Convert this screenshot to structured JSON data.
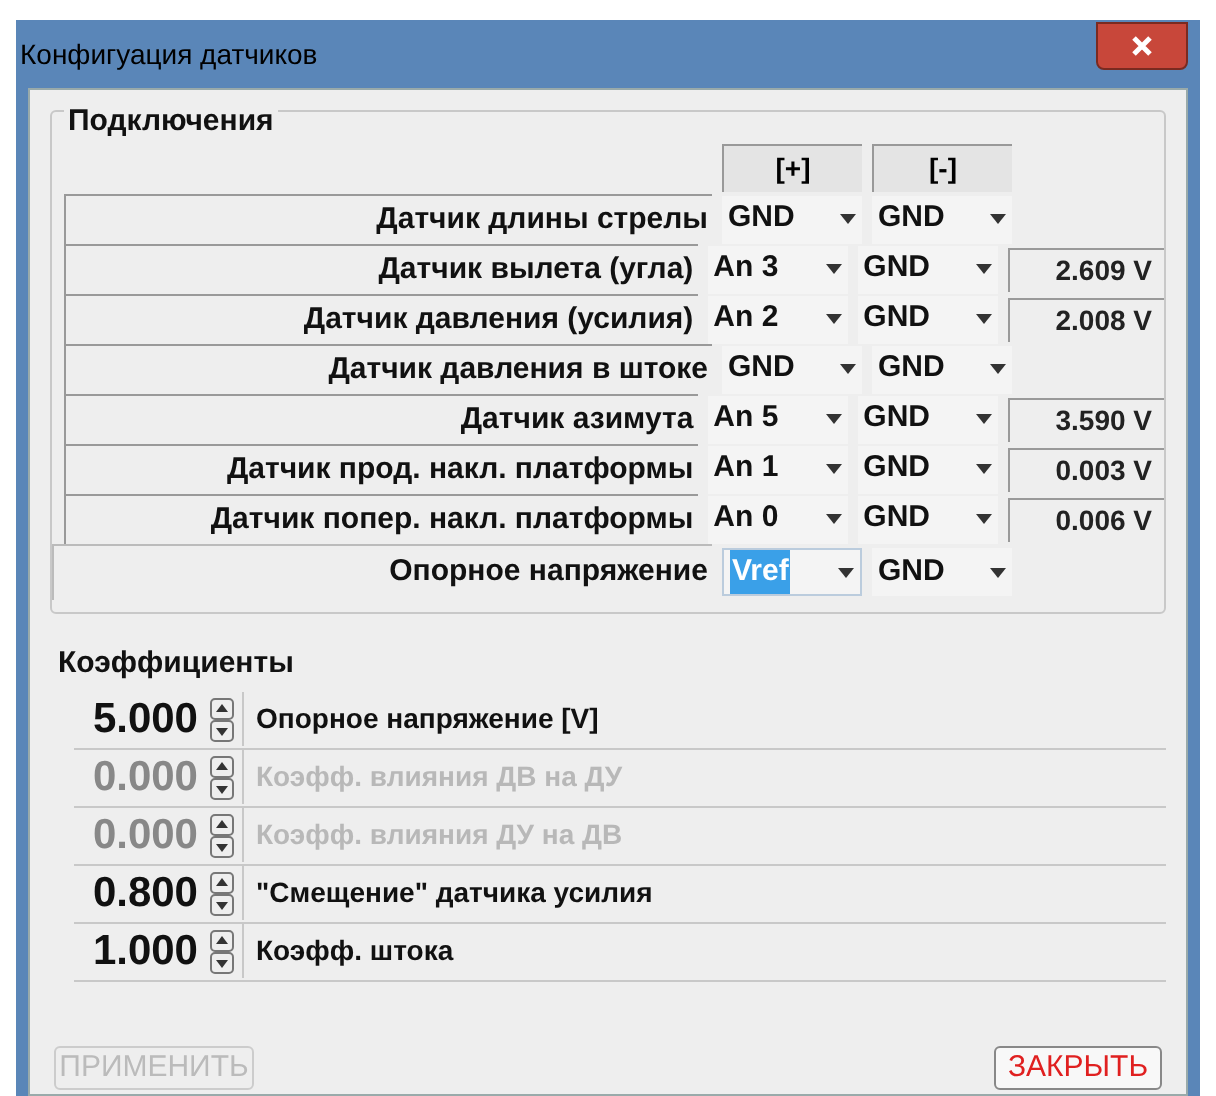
{
  "window": {
    "title": "Конфигуация датчиков"
  },
  "connections": {
    "title": "Подключения",
    "headers": [
      "[+]",
      "[-]"
    ],
    "rows": [
      {
        "label": "Датчик длины стрелы",
        "plus": "GND",
        "minus": "GND"
      },
      {
        "label": "Датчик вылета (угла)",
        "plus": "An 3",
        "minus": "GND",
        "reading": "2.609 V"
      },
      {
        "label": "Датчик давления (усилия)",
        "plus": "An 2",
        "minus": "GND",
        "reading": "2.008 V"
      },
      {
        "label": "Датчик давления в штоке",
        "plus": "GND",
        "minus": "GND"
      },
      {
        "label": "Датчик азимута",
        "plus": "An 5",
        "minus": "GND",
        "reading": "3.590 V"
      },
      {
        "label": "Датчик прод.  накл. платформы",
        "plus": "An 1",
        "minus": "GND",
        "reading": "0.003 V"
      },
      {
        "label": "Датчик попер. накл. платформы",
        "plus": "An 0",
        "minus": "GND",
        "reading": "0.006 V"
      }
    ],
    "reference": {
      "label": "Опорное напряжение",
      "plus": "Vref",
      "plus_selected": true,
      "minus": "GND"
    }
  },
  "coefficients": {
    "title": "Коэффициенты",
    "rows": [
      {
        "value": "5.000",
        "label": "Опорное напряжение [V]",
        "disabled": false
      },
      {
        "value": "0.000",
        "label": "Коэфф. влияния ДВ на ДУ",
        "disabled": true
      },
      {
        "value": "0.000",
        "label": "Коэфф. влияния ДУ на ДВ",
        "disabled": true
      },
      {
        "value": "0.800",
        "label": "\"Смещение\" датчика усилия",
        "disabled": false
      },
      {
        "value": "1.000",
        "label": "Коэфф. штока",
        "disabled": false
      }
    ]
  },
  "buttons": [
    {
      "label": "ПРИМЕНИТЬ",
      "disabled": true
    },
    {
      "label": "ЗАКРЫТЬ",
      "disabled": false
    }
  ]
}
